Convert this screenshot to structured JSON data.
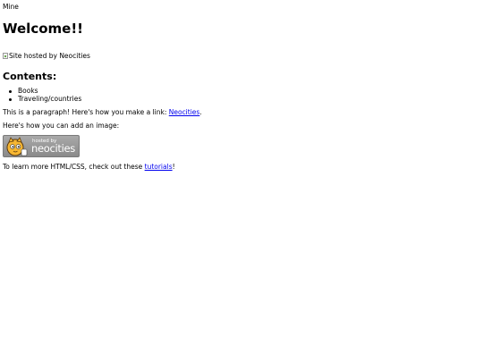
{
  "header": {
    "text": "Mine"
  },
  "heading": {
    "title": "Welcome!!"
  },
  "hosted_image": {
    "alt": "Site hosted by Neocities"
  },
  "contents": {
    "title": "Contents:",
    "items": [
      "Books",
      "Traveling/countries"
    ]
  },
  "paragraph_link": {
    "before": "This is a paragraph! Here's how you make a link: ",
    "link_text": "Neocities",
    "after": "."
  },
  "image_hint": {
    "text": "Here's how you can add an image:"
  },
  "badge": {
    "small_text": "hosted by",
    "brand_text": "neocities",
    "icon": "neocities-cat-icon"
  },
  "learn_more": {
    "before": "To learn more HTML/CSS, check out these ",
    "link_text": "tutorials",
    "after": "!"
  },
  "colors": {
    "link": "#0000ee",
    "badge_bg": "#9a9a9a"
  }
}
